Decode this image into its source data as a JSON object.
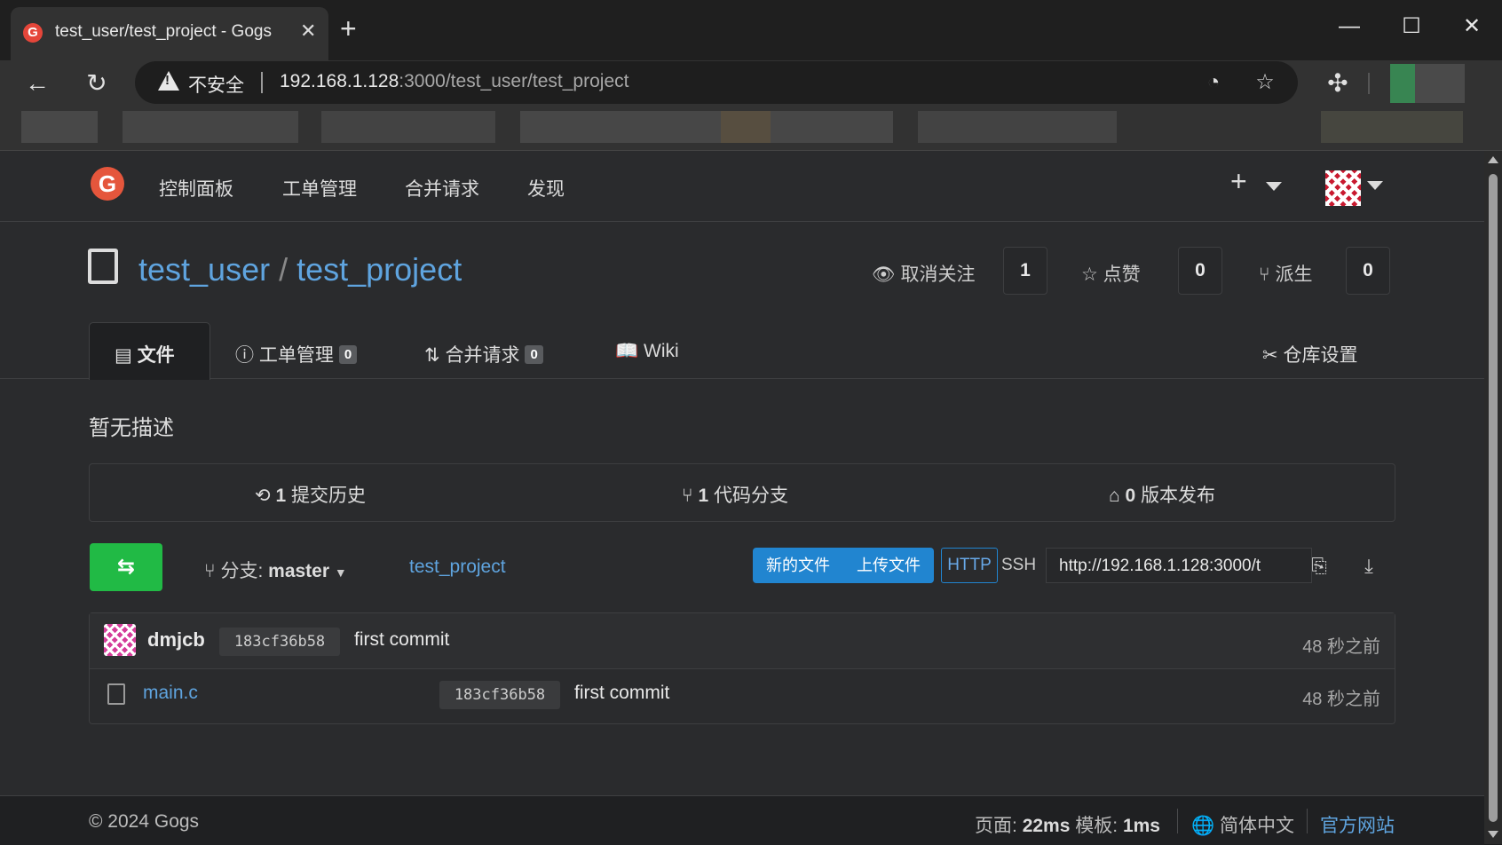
{
  "browser": {
    "tab_title": "test_user/test_project - Gogs",
    "favicon_letter": "G",
    "url_host": "192.168.1.128",
    "url_rest": ":3000/test_user/test_project",
    "insecure_label": "不安全"
  },
  "nav": {
    "items": [
      "控制面板",
      "工单管理",
      "合并请求",
      "发现"
    ]
  },
  "repo": {
    "owner": "test_user",
    "name": "test_project",
    "watch_label": "取消关注",
    "watch_count": "1",
    "star_label": "点赞",
    "star_count": "0",
    "fork_label": "派生",
    "fork_count": "0"
  },
  "tabs": {
    "files": "文件",
    "issues": "工单管理",
    "issues_count": "0",
    "pulls": "合并请求",
    "pulls_count": "0",
    "wiki": "Wiki",
    "settings": "仓库设置"
  },
  "description": "暂无描述",
  "stats": {
    "commits_count": "1",
    "commits_label": "提交历史",
    "branches_count": "1",
    "branches_label": "代码分支",
    "releases_count": "0",
    "releases_label": "版本发布"
  },
  "toolbar": {
    "branch_prefix": "分支:",
    "branch": "master",
    "breadcrumb": "test_project",
    "new_file": "新的文件",
    "upload_file": "上传文件",
    "http": "HTTP",
    "ssh": "SSH",
    "clone_url": "http://192.168.1.128:3000/t"
  },
  "latest_commit": {
    "author": "dmjcb",
    "sha": "183cf36b58",
    "message": "first commit",
    "age": "48 秒之前"
  },
  "files": [
    {
      "name": "main.c",
      "sha": "183cf36b58",
      "message": "first commit",
      "age": "48 秒之前"
    }
  ],
  "footer": {
    "copyright": "© 2024 Gogs",
    "page_label": "页面:",
    "page_time": "22ms",
    "template_label": "模板:",
    "template_time": "1ms",
    "language": "简体中文",
    "official_site": "官方网站"
  }
}
